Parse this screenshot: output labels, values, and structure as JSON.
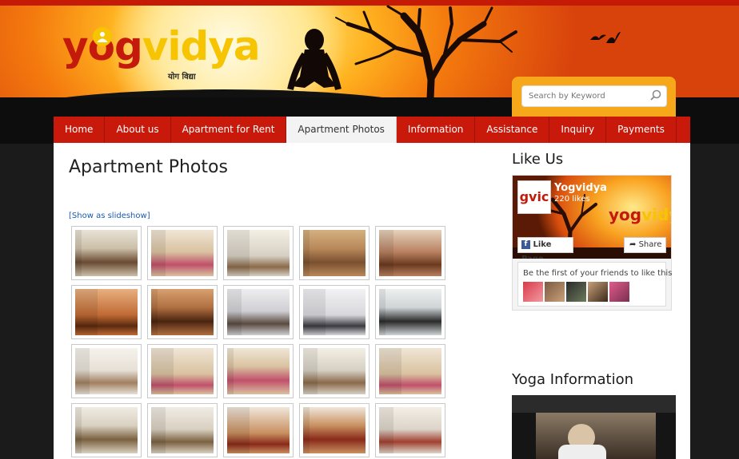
{
  "site": {
    "logo_yo": "yog",
    "logo_vidya": "vidya",
    "logo_hindi": "योग विद्या"
  },
  "search": {
    "placeholder": "Search by Keyword",
    "icon": "search-icon"
  },
  "nav": {
    "items": [
      {
        "label": "Home"
      },
      {
        "label": "About us"
      },
      {
        "label": "Apartment for Rent"
      },
      {
        "label": "Apartment Photos",
        "active": true
      },
      {
        "label": "Information"
      },
      {
        "label": "Assistance"
      },
      {
        "label": "Inquiry"
      },
      {
        "label": "Payments"
      }
    ]
  },
  "main": {
    "title": "Apartment Photos",
    "slideshow_link": "[Show as slideshow]",
    "thumbnails": [
      {
        "subject": "living room"
      },
      {
        "subject": "bedroom"
      },
      {
        "subject": "bedroom window"
      },
      {
        "subject": "wardrobe"
      },
      {
        "subject": "dining area"
      },
      {
        "subject": "dining room"
      },
      {
        "subject": "dining table"
      },
      {
        "subject": "glass table"
      },
      {
        "subject": "kitchen"
      },
      {
        "subject": "kitchen counter"
      },
      {
        "subject": "doorway"
      },
      {
        "subject": "bedroom"
      },
      {
        "subject": "bedroom"
      },
      {
        "subject": "bedroom window"
      },
      {
        "subject": "bedroom"
      },
      {
        "subject": "sofa set"
      },
      {
        "subject": "sofa set"
      },
      {
        "subject": "tv unit"
      },
      {
        "subject": "tv unit"
      },
      {
        "subject": "hall"
      }
    ]
  },
  "sidebar": {
    "like_title": "Like Us",
    "fb": {
      "page_name": "Yogvidya",
      "likes": "220 likes",
      "avatar_text": "gvic",
      "like_button": "Like Page",
      "share_button": "Share",
      "friends_text": "Be the first of your friends to like this"
    },
    "info_title": "Yoga Information"
  },
  "colors": {
    "nav_red": "#c8190b",
    "logo_red": "#c41a0b",
    "logo_yellow": "#f6c400",
    "search_orange": "#f6a81a",
    "link_blue": "#1a5ab2"
  }
}
